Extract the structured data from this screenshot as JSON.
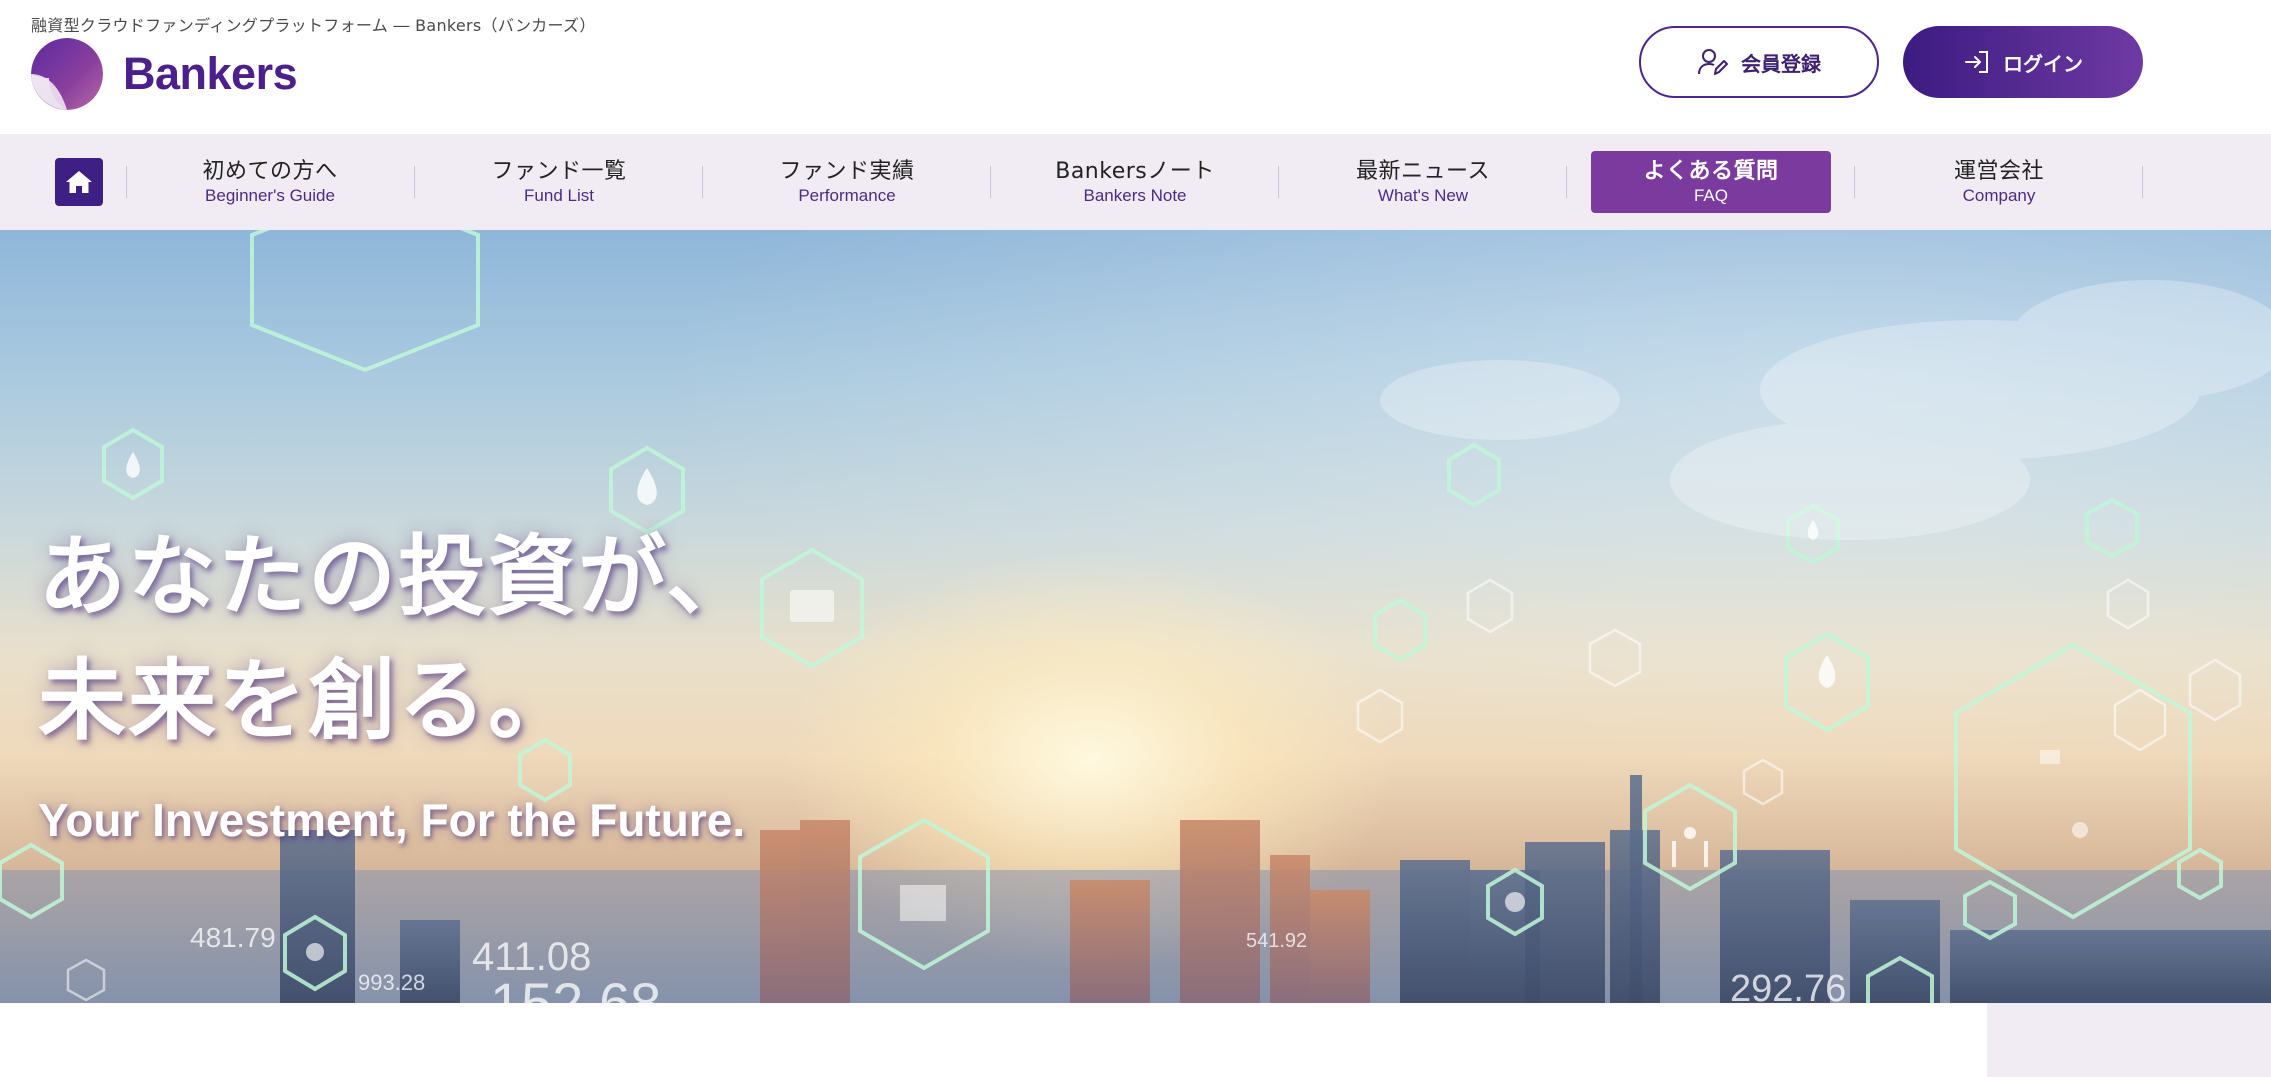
{
  "header": {
    "tagline": "融資型クラウドファンディングプラットフォーム ― Bankers（バンカーズ）",
    "logo_text": "Bankers",
    "register_label": "会員登録",
    "login_label": "ログイン",
    "register_icon": "user-edit-icon",
    "login_icon": "sign-in-icon"
  },
  "nav": {
    "home_icon": "home-icon",
    "items": [
      {
        "jp": "初めての方へ",
        "en": "Beginner's Guide"
      },
      {
        "jp": "ファンド一覧",
        "en": "Fund List"
      },
      {
        "jp": "ファンド実績",
        "en": "Performance"
      },
      {
        "jp": "Bankersノート",
        "en": "Bankers Note"
      },
      {
        "jp": "最新ニュース",
        "en": "What's New"
      },
      {
        "jp": "よくある質問",
        "en": "FAQ"
      },
      {
        "jp": "運営会社",
        "en": "Company"
      }
    ],
    "active_index": 5
  },
  "hero": {
    "title_line1": "あなたの投資が、",
    "title_line2": "未来を創る。",
    "subtitle": "Your Investment, For the Future.",
    "numbers": [
      "481.79",
      "993.28",
      "411.08",
      "152.68",
      "292.76",
      "541.92"
    ]
  },
  "colors": {
    "brand": "#4b1f8c",
    "nav_bg": "#f1ebf3",
    "active_tab": "#7b3b9e",
    "login_gradient_start": "#3c1b80",
    "login_gradient_end": "#6e3aa3"
  }
}
